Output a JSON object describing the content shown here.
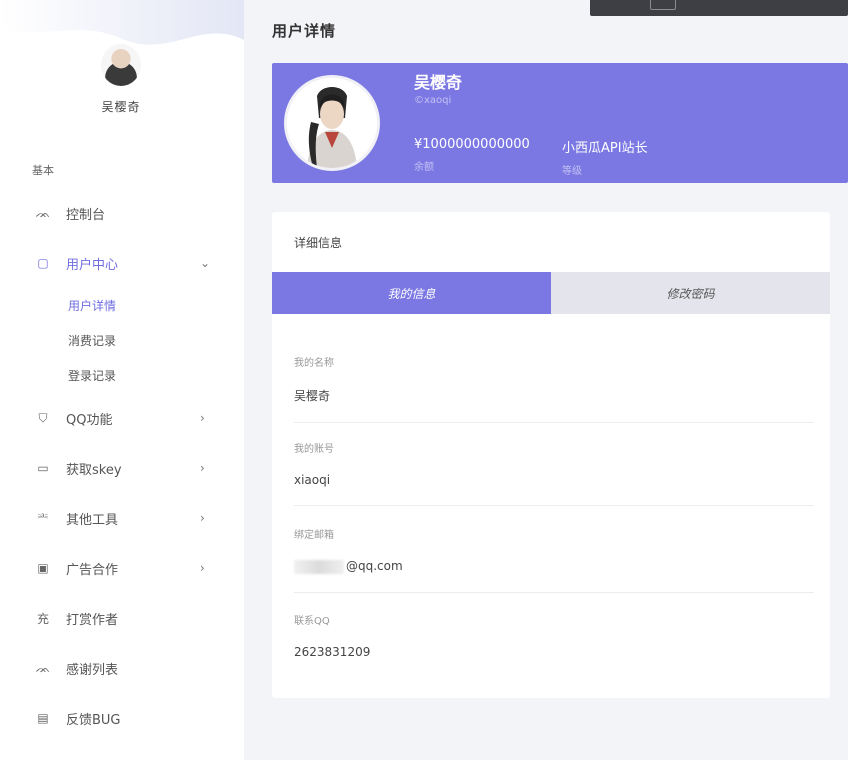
{
  "sidebar": {
    "user_name": "吴樱奇",
    "section_label": "基本",
    "nav": [
      {
        "label": "控制台",
        "icon": "dashboard-icon",
        "glyph": "ᨏ"
      },
      {
        "label": "用户中心",
        "icon": "user-card-icon",
        "glyph": "▢",
        "arrow": "⌄"
      },
      {
        "label": "QQ功能",
        "icon": "shield-icon",
        "glyph": "⛉",
        "arrow": "›"
      },
      {
        "label": "获取skey",
        "icon": "monitor-icon",
        "glyph": "▭",
        "arrow": "›"
      },
      {
        "label": "其他工具",
        "icon": "tools-icon",
        "glyph": "⎃",
        "arrow": "›"
      },
      {
        "label": "广告合作",
        "icon": "ad-icon",
        "glyph": "▣",
        "arrow": "›"
      },
      {
        "label": "打赏作者",
        "icon": "gift-icon",
        "glyph": "充"
      },
      {
        "label": "感谢列表",
        "icon": "speed-icon",
        "glyph": "ᨏ"
      },
      {
        "label": "反馈BUG",
        "icon": "bug-report-icon",
        "glyph": "▤"
      }
    ],
    "sub_items": [
      "用户详情",
      "消费记录",
      "登录记录"
    ]
  },
  "page": {
    "title": "用户详情"
  },
  "banner": {
    "name": "吴樱奇",
    "subtitle": "©xaoqi",
    "balance_value": "¥1000000000000",
    "balance_label": "余额",
    "level_value": "小西瓜API站长",
    "level_label": "等级"
  },
  "card": {
    "title": "详细信息",
    "tabs": [
      "我的信息",
      "修改密码"
    ],
    "fields": [
      {
        "label": "我的名称",
        "value": "吴樱奇"
      },
      {
        "label": "我的账号",
        "value": "xiaoqi"
      },
      {
        "label": "绑定邮箱",
        "value": "@qq.com"
      },
      {
        "label": "联系QQ",
        "value": "2623831209"
      }
    ]
  },
  "colors": {
    "accent": "#7b78e3",
    "tab_inactive": "#e4e5ec",
    "background": "#f3f4f8"
  }
}
